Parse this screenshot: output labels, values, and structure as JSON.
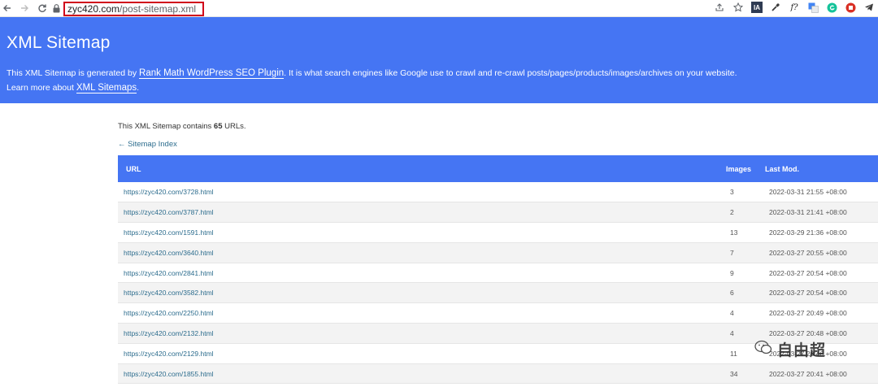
{
  "browser": {
    "url_host": "zyc420.com",
    "url_path": "/post-sitemap.xml",
    "extensions": [
      "share-icon",
      "star-icon",
      "ia-icon",
      "eyedropper-icon",
      "formula-icon",
      "translate-icon",
      "grammarly-icon",
      "other-icon",
      "telegram-icon"
    ],
    "ia_label": "IA",
    "formula_label": "f?"
  },
  "header": {
    "title": "XML Sitemap",
    "desc_prefix": "This XML Sitemap is generated by ",
    "plugin_link": "Rank Math WordPress SEO Plugin",
    "desc_suffix": ". It is what search engines like Google use to crawl and re-crawl posts/pages/products/images/archives on your website.",
    "learn_prefix": "Learn more about ",
    "learn_link": "XML Sitemaps",
    "learn_suffix": "."
  },
  "summary": {
    "prefix": "This XML Sitemap contains ",
    "count": "65",
    "suffix": " URLs."
  },
  "index_link": "← Sitemap Index",
  "table": {
    "headers": {
      "url": "URL",
      "images": "Images",
      "lastmod": "Last Mod."
    },
    "rows": [
      {
        "url": "https://zyc420.com/3728.html",
        "images": "3",
        "lastmod": "2022-03-31 21:55 +08:00"
      },
      {
        "url": "https://zyc420.com/3787.html",
        "images": "2",
        "lastmod": "2022-03-31 21:41 +08:00"
      },
      {
        "url": "https://zyc420.com/1591.html",
        "images": "13",
        "lastmod": "2022-03-29 21:36 +08:00"
      },
      {
        "url": "https://zyc420.com/3640.html",
        "images": "7",
        "lastmod": "2022-03-27 20:55 +08:00"
      },
      {
        "url": "https://zyc420.com/2841.html",
        "images": "9",
        "lastmod": "2022-03-27 20:54 +08:00"
      },
      {
        "url": "https://zyc420.com/3582.html",
        "images": "6",
        "lastmod": "2022-03-27 20:54 +08:00"
      },
      {
        "url": "https://zyc420.com/2250.html",
        "images": "4",
        "lastmod": "2022-03-27 20:49 +08:00"
      },
      {
        "url": "https://zyc420.com/2132.html",
        "images": "4",
        "lastmod": "2022-03-27 20:48 +08:00"
      },
      {
        "url": "https://zyc420.com/2129.html",
        "images": "11",
        "lastmod": "2022-03-27 20:46 +08:00"
      },
      {
        "url": "https://zyc420.com/1855.html",
        "images": "34",
        "lastmod": "2022-03-27 20:41 +08:00"
      }
    ]
  },
  "watermark": "自由超"
}
